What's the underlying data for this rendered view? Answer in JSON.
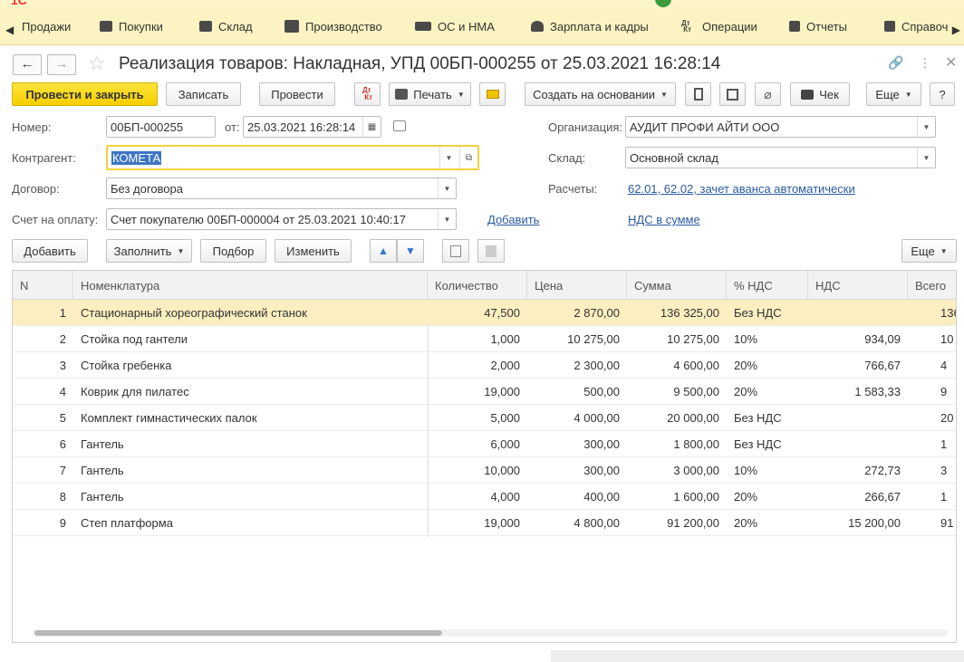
{
  "sections": [
    {
      "label": "Продажи",
      "icon": "sales-icon"
    },
    {
      "label": "Покупки",
      "icon": "cart-icon"
    },
    {
      "label": "Склад",
      "icon": "warehouse-icon"
    },
    {
      "label": "Производство",
      "icon": "factory-icon"
    },
    {
      "label": "ОС и НМА",
      "icon": "truck-icon"
    },
    {
      "label": "Зарплата и кадры",
      "icon": "person-icon"
    },
    {
      "label": "Операции",
      "icon": "dt-kt-icon"
    },
    {
      "label": "Отчеты",
      "icon": "bar-chart-icon"
    },
    {
      "label": "Справоч",
      "icon": "book-icon"
    }
  ],
  "document": {
    "title": "Реализация товаров: Накладная, УПД 00БП-000255 от 25.03.2021 16:28:14"
  },
  "toolbar": {
    "post_and_close": "Провести и закрыть",
    "save": "Записать",
    "post": "Провести",
    "print": "Печать",
    "create_based_on": "Создать на основании",
    "receipt": "Чек",
    "more": "Еще",
    "help": "?"
  },
  "form": {
    "number_label": "Номер:",
    "number_value": "00БП-000255",
    "date_label": "от:",
    "date_value": "25.03.2021 16:28:14",
    "contractor_label": "Контрагент:",
    "contractor_value": "КОМЕТА",
    "contract_label": "Договор:",
    "contract_value": "Без договора",
    "invoice_label": "Счет на оплату:",
    "invoice_value": "Счет покупателю 00БП-000004 от 25.03.2021 10:40:17",
    "invoice_add": "Добавить",
    "org_label": "Организация:",
    "org_value": "АУДИТ ПРОФИ АЙТИ ООО",
    "warehouse_label": "Склад:",
    "warehouse_value": "Основной склад",
    "settlements_label": "Расчеты:",
    "settlements_link": "62.01, 62.02, зачет аванса автоматически",
    "vat_link": "НДС в сумме"
  },
  "table_toolbar": {
    "add": "Добавить",
    "fill": "Заполнить",
    "select": "Подбор",
    "change": "Изменить",
    "more": "Еще"
  },
  "table": {
    "headers": [
      "N",
      "Номенклатура",
      "Количество",
      "Цена",
      "Сумма",
      "% НДС",
      "НДС",
      "Всего"
    ],
    "rows": [
      {
        "n": "1",
        "name": "Стационарный хореографический станок",
        "qty": "47,500",
        "price": "2 870,00",
        "sum": "136 325,00",
        "vat_rate": "Без НДС",
        "vat": "",
        "total": "136"
      },
      {
        "n": "2",
        "name": "Стойка под гантели",
        "qty": "1,000",
        "price": "10 275,00",
        "sum": "10 275,00",
        "vat_rate": "10%",
        "vat": "934,09",
        "total": "10"
      },
      {
        "n": "3",
        "name": "Стойка гребенка",
        "qty": "2,000",
        "price": "2 300,00",
        "sum": "4 600,00",
        "vat_rate": "20%",
        "vat": "766,67",
        "total": "4"
      },
      {
        "n": "4",
        "name": "Коврик для пилатес",
        "qty": "19,000",
        "price": "500,00",
        "sum": "9 500,00",
        "vat_rate": "20%",
        "vat": "1 583,33",
        "total": "9"
      },
      {
        "n": "5",
        "name": "Комплект гимнастических палок",
        "qty": "5,000",
        "price": "4 000,00",
        "sum": "20 000,00",
        "vat_rate": "Без НДС",
        "vat": "",
        "total": "20"
      },
      {
        "n": "6",
        "name": "Гантель",
        "qty": "6,000",
        "price": "300,00",
        "sum": "1 800,00",
        "vat_rate": "Без НДС",
        "vat": "",
        "total": "1"
      },
      {
        "n": "7",
        "name": "Гантель",
        "qty": "10,000",
        "price": "300,00",
        "sum": "3 000,00",
        "vat_rate": "10%",
        "vat": "272,73",
        "total": "3"
      },
      {
        "n": "8",
        "name": "Гантель",
        "qty": "4,000",
        "price": "400,00",
        "sum": "1 600,00",
        "vat_rate": "20%",
        "vat": "266,67",
        "total": "1"
      },
      {
        "n": "9",
        "name": "Степ платформа",
        "qty": "19,000",
        "price": "4 800,00",
        "sum": "91 200,00",
        "vat_rate": "20%",
        "vat": "15 200,00",
        "total": "91"
      }
    ]
  }
}
